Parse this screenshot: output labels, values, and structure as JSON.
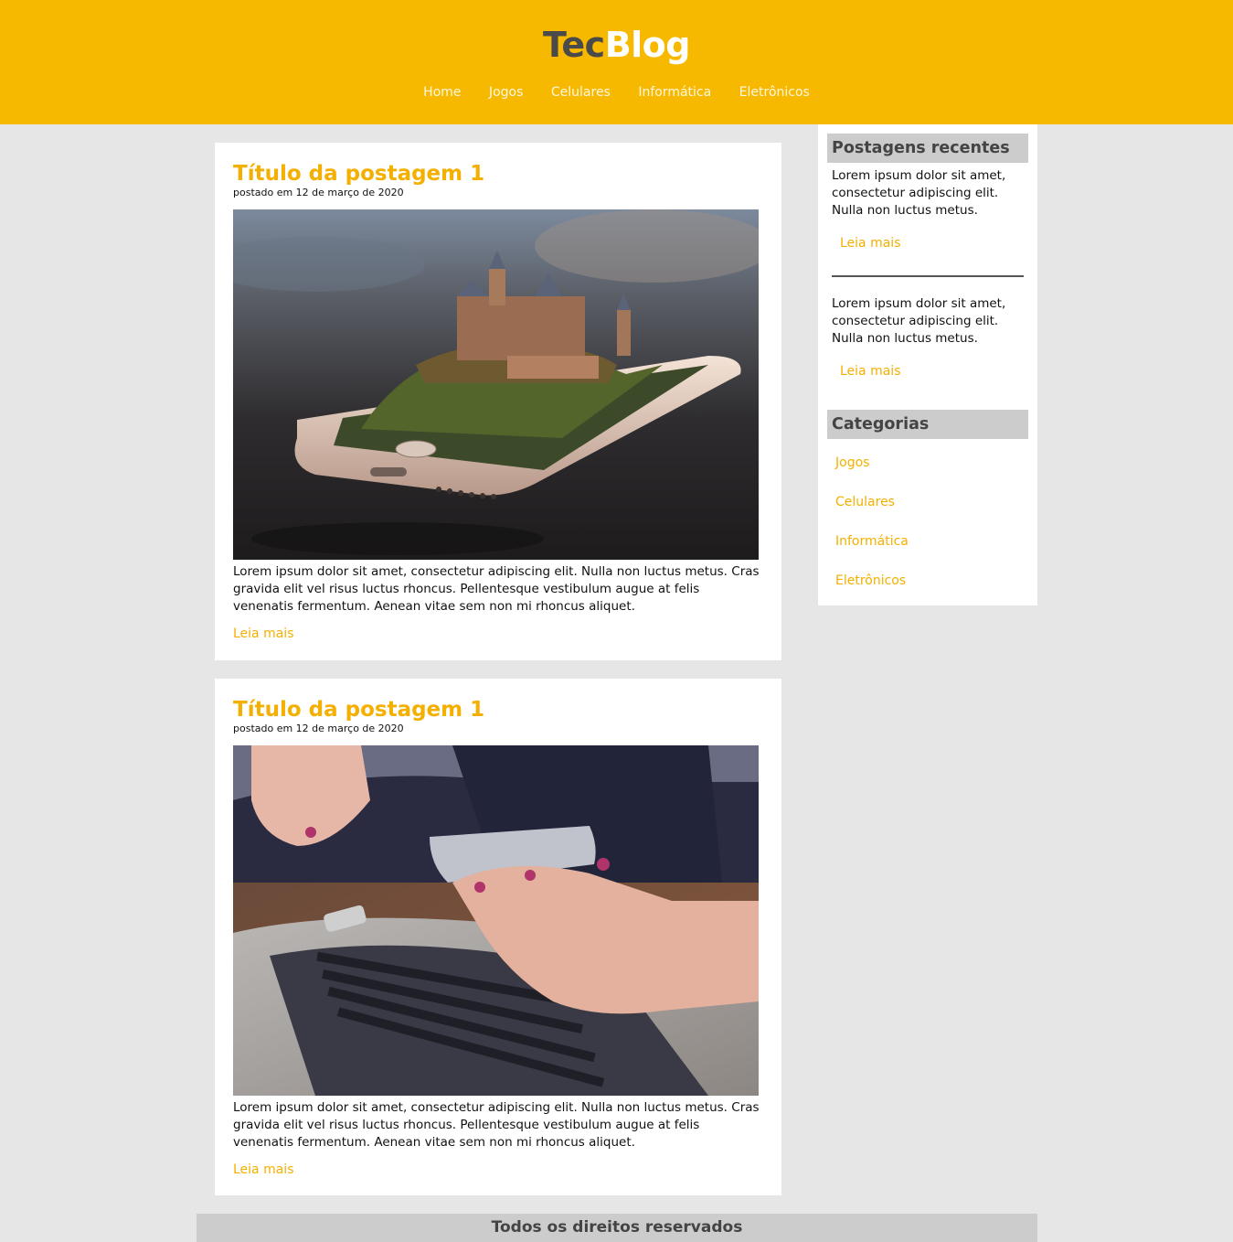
{
  "header": {
    "logo_part1": "Tec",
    "logo_part2": "Blog",
    "nav": [
      "Home",
      "Jogos",
      "Celulares",
      "Informática",
      "Eletrônicos"
    ]
  },
  "posts": [
    {
      "title": "Título da postagem 1",
      "date": "postado em 12 de março de 2020",
      "image": "phone-castle-photo",
      "text": "Lorem ipsum dolor sit amet, consectetur adipiscing elit. Nulla non luctus metus. Cras gravida elit vel risus luctus rhoncus. Pellentesque vestibulum augue at felis venenatis fermentum. Aenean vitae sem non mi rhoncus aliquet.",
      "read_more": "Leia mais"
    },
    {
      "title": "Título da postagem 1",
      "date": "postado em 12 de março de 2020",
      "image": "hands-phone-laptop-photo",
      "text": "Lorem ipsum dolor sit amet, consectetur adipiscing elit. Nulla non luctus metus. Cras gravida elit vel risus luctus rhoncus. Pellentesque vestibulum augue at felis venenatis fermentum. Aenean vitae sem non mi rhoncus aliquet.",
      "read_more": "Leia mais"
    }
  ],
  "sidebar": {
    "recent_heading": "Postagens recentes",
    "recent": [
      {
        "text": "Lorem ipsum dolor sit amet, consectetur adipiscing elit. Nulla non luctus metus.",
        "read_more": "Leia mais"
      },
      {
        "text": "Lorem ipsum dolor sit amet, consectetur adipiscing elit. Nulla non luctus metus.",
        "read_more": "Leia mais"
      }
    ],
    "categories_heading": "Categorias",
    "categories": [
      "Jogos",
      "Celulares",
      "Informática",
      "Eletrônicos"
    ]
  },
  "footer": {
    "text": "Todos os direitos reservados"
  },
  "colors": {
    "header_bg": "#f7b900",
    "accent": "#f4b000",
    "page_bg": "#e6e6e6",
    "heading_bg": "#cccccc"
  }
}
